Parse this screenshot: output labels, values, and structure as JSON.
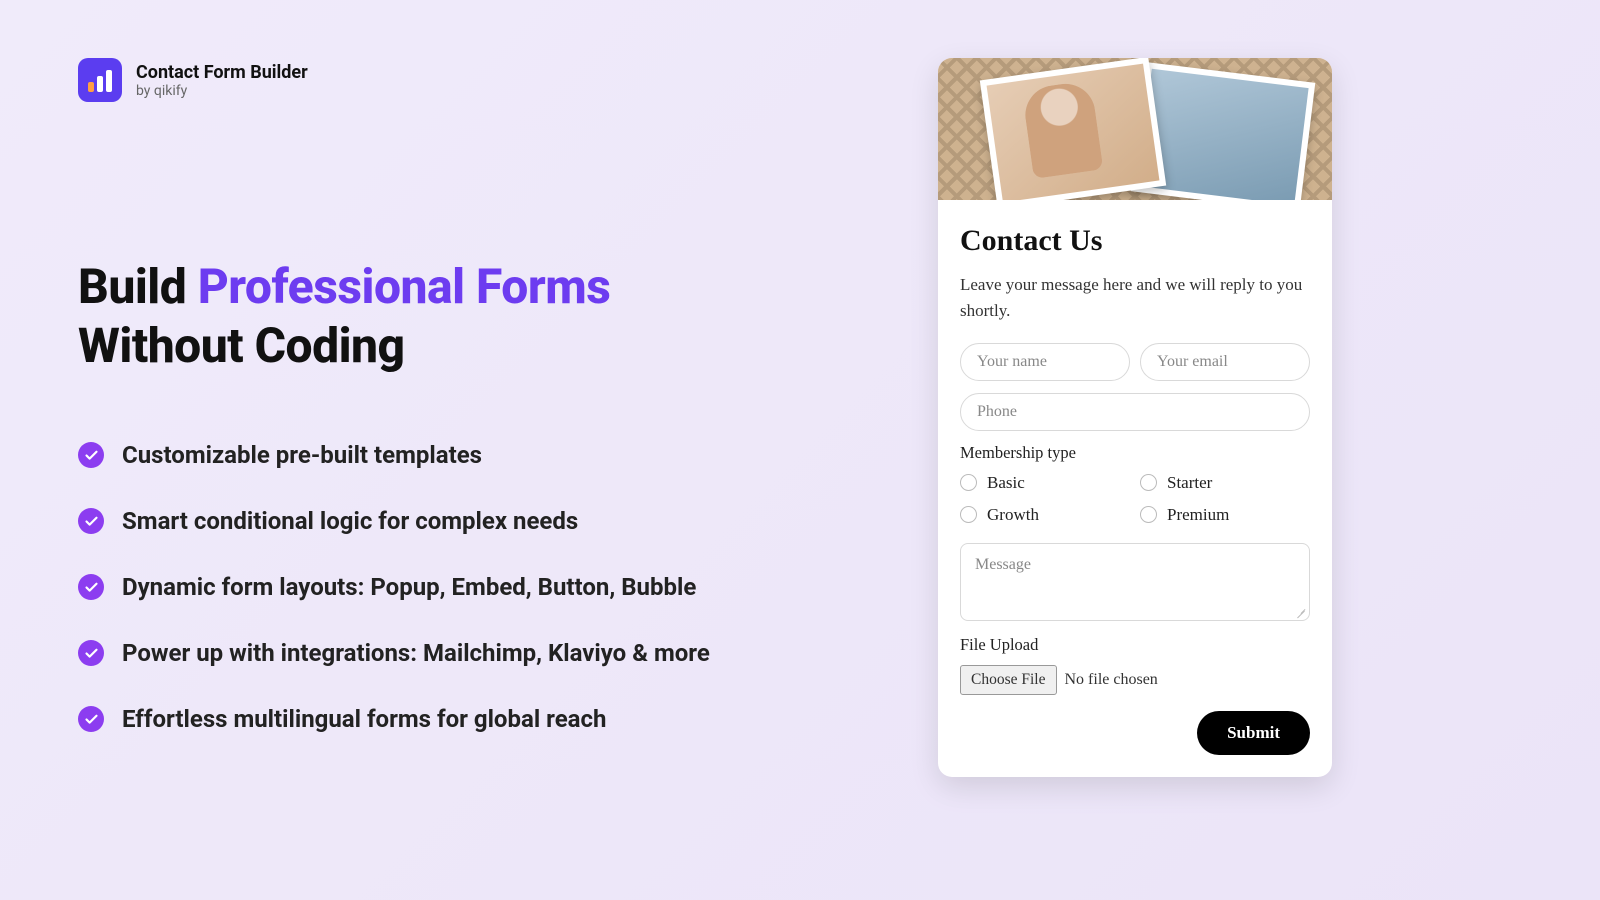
{
  "brand": {
    "title": "Contact Form Builder",
    "byline": "by qikify"
  },
  "headline": {
    "part1": "Build ",
    "accent": "Professional Forms",
    "part2": " Without Coding"
  },
  "bullets": [
    "Customizable pre-built templates",
    "Smart conditional logic for complex needs",
    "Dynamic form layouts:  Popup, Embed, Button, Bubble",
    "Power up with integrations: Mailchimp, Klaviyo & more",
    "Effortless multilingual forms for global reach"
  ],
  "form": {
    "title": "Contact Us",
    "description": "Leave your message here and we will reply to you shortly.",
    "placeholders": {
      "name": "Your name",
      "email": "Your email",
      "phone": "Phone",
      "message": "Message"
    },
    "membership_label": "Membership type",
    "membership_options": [
      "Basic",
      "Starter",
      "Growth",
      "Premium"
    ],
    "file_label": "File Upload",
    "choose_file": "Choose File",
    "no_file": "No file chosen",
    "submit": "Submit"
  },
  "colors": {
    "accent": "#6d3cf0",
    "check": "#8c3df0"
  }
}
